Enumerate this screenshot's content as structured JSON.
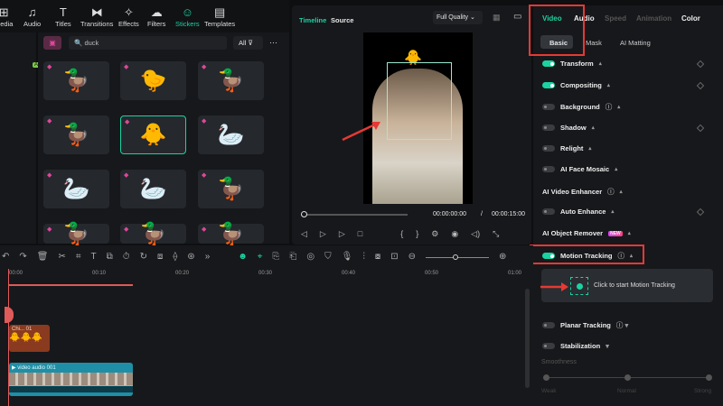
{
  "nav": {
    "items": [
      {
        "label": "Media",
        "icon": "media-icon"
      },
      {
        "label": "Audio",
        "icon": "music-icon"
      },
      {
        "label": "Titles",
        "icon": "text-icon"
      },
      {
        "label": "Transitions",
        "icon": "transition-icon"
      },
      {
        "label": "Effects",
        "icon": "effects-icon"
      },
      {
        "label": "Filters",
        "icon": "filters-icon"
      },
      {
        "label": "Stickers",
        "icon": "sticker-icon",
        "active": true
      },
      {
        "label": "Templates",
        "icon": "templates-icon"
      }
    ]
  },
  "stickers": {
    "search_value": "duck",
    "filter": "All",
    "more": "···",
    "left_badge": "AI",
    "tiles": [
      "🦆",
      "🐤",
      "🦆",
      "🦆",
      "🐥",
      "🦢",
      "🦢",
      "🦢",
      "🦆",
      "🦆",
      "🦆",
      "🦆"
    ]
  },
  "preview": {
    "tabs": [
      "Timeline",
      "Source"
    ],
    "quality": "Full Quality",
    "current_time": "00:00:00:00",
    "separator": "/",
    "total_time": "00:00:15:00"
  },
  "right": {
    "tabs": [
      "Video",
      "Audio",
      "Speed",
      "Animation",
      "Color"
    ],
    "subtabs": [
      "Basic",
      "Mask",
      "AI Matting"
    ],
    "rows": [
      {
        "label": "Transform",
        "toggle": "on",
        "kf": true
      },
      {
        "label": "Compositing",
        "toggle": "on",
        "kf": true
      },
      {
        "label": "Background",
        "toggle": "off",
        "help": true
      },
      {
        "label": "Shadow",
        "toggle": "off",
        "kf": true
      },
      {
        "label": "Relight",
        "toggle": "off"
      },
      {
        "label": "AI Face Mosaic",
        "toggle": "off"
      },
      {
        "label": "AI Video Enhancer",
        "help": true
      },
      {
        "label": "Auto Enhance",
        "toggle": "off",
        "kf": true
      },
      {
        "label": "AI Object Remover",
        "badge": "NEW"
      },
      {
        "label": "Motion Tracking",
        "toggle": "on",
        "help": true
      }
    ],
    "motion_hint": "Click to start Motion Tracking",
    "planar": "Planar Tracking",
    "stabilization": "Stabilization",
    "smoothness": "Smoothness",
    "slider_labels": [
      "Weak",
      "Normal",
      "Strong"
    ]
  },
  "timeline": {
    "ticks": [
      "00:00",
      "00:10",
      "00:20",
      "00:30",
      "00:40",
      "00:50",
      "01:00"
    ],
    "sticker_clip": "Chi... 01",
    "video_clip": "video audio 001"
  },
  "colors": {
    "accent": "#19d3a2",
    "annotation": "#e53935"
  }
}
